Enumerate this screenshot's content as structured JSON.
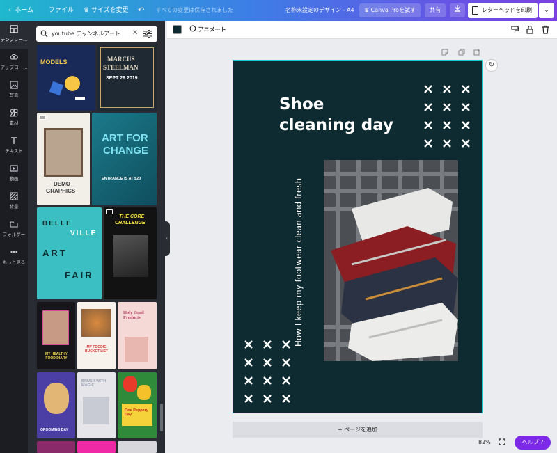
{
  "topbar": {
    "back_label": "ホーム",
    "file_label": "ファイル",
    "resize_label": "サイズを変更",
    "save_status": "すべての変更は保存されました",
    "doc_title": "名称未設定のデザイン - A4",
    "pro_label": "Canva Proを試す",
    "share_label": "共有",
    "print_label": "レターヘッドを印刷"
  },
  "sidebar": {
    "items": [
      {
        "label": "テンプレー...",
        "icon": "template-icon"
      },
      {
        "label": "アップロー...",
        "icon": "upload-icon"
      },
      {
        "label": "写真",
        "icon": "photo-icon"
      },
      {
        "label": "素材",
        "icon": "elements-icon"
      },
      {
        "label": "テキスト",
        "icon": "text-icon"
      },
      {
        "label": "動画",
        "icon": "video-icon"
      },
      {
        "label": "背景",
        "icon": "background-icon"
      },
      {
        "label": "フォルダー",
        "icon": "folder-icon"
      },
      {
        "label": "もっと見る",
        "icon": "more-icon"
      }
    ]
  },
  "panel": {
    "search_value": "youtube チャンネルアート",
    "thumbs": {
      "t1": "MODELS",
      "t2a": "MARCUS",
      "t2b": "STEELMAN",
      "t2c": "SEPT 29 2019",
      "t3a": "DEMO",
      "t3b": "GRAPHICS",
      "t4a": "ART FOR",
      "t4b": "CHANGE",
      "t4c": "ENTRANCE IS AT $20",
      "t5a": "BELLE",
      "t5b": "VILLE",
      "t5c": "ART",
      "t5d": "FAIR",
      "t6a": "THE CORE",
      "t6b": "CHALLENGE",
      "t7": "MY HEALTHY FOOD DIARY",
      "t8": "MY FOODIE BUCKET LIST",
      "t9": "Holy Grail Products",
      "t10": "GROOMING DAY",
      "t11": "BRUSH WITH MAGIC",
      "t12": "One Peppery Day"
    }
  },
  "toolbar": {
    "animate_label": "アニメート",
    "swatch_color": "#0d2b30"
  },
  "design": {
    "title_line1": "Shoe",
    "title_line2": "cleaning day",
    "vertical_text": "How I keep my footwear clean and fresh",
    "background_color": "#0d2b30",
    "accent_color": "#ffffff"
  },
  "canvas": {
    "add_page_label": "+ ページを追加",
    "zoom": "82%",
    "help_label": "ヘルプ ?"
  }
}
